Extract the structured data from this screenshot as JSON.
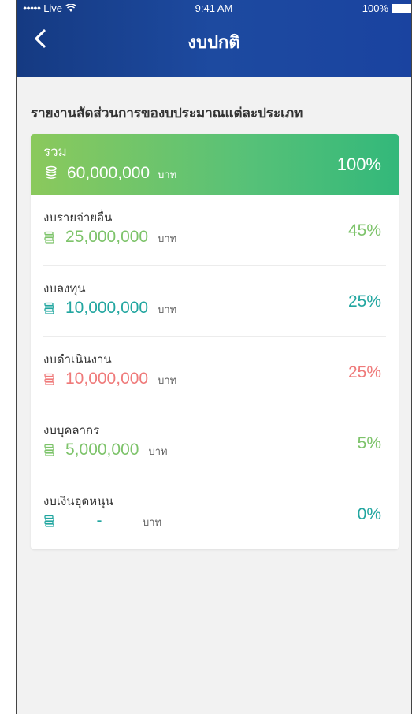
{
  "status_bar": {
    "carrier": "Live",
    "time": "9:41 AM",
    "battery": "100%"
  },
  "nav": {
    "title": "งบปกติ"
  },
  "section_title": "รายงานสัดส่วนการของบประมาณแต่ละประเภท",
  "total": {
    "label": "รวม",
    "amount": "60,000,000",
    "unit": "บาท",
    "percent": "100%"
  },
  "items": [
    {
      "label": "งบรายจ่ายอื่น",
      "amount": "25,000,000",
      "unit": "บาท",
      "percent": "45%",
      "color": "#7dc36a"
    },
    {
      "label": "งบลงทุน",
      "amount": "10,000,000",
      "unit": "บาท",
      "percent": "25%",
      "color": "#22a6a0"
    },
    {
      "label": "งบดำเนินงาน",
      "amount": "10,000,000",
      "unit": "บาท",
      "percent": "25%",
      "color": "#ef7a7a"
    },
    {
      "label": "งบบุคลากร",
      "amount": "5,000,000",
      "unit": "บาท",
      "percent": "5%",
      "color": "#7dc36a"
    },
    {
      "label": "งบเงินอุดหนุน",
      "amount": "-",
      "unit": "บาท",
      "percent": "0%",
      "color": "#22a6a0"
    }
  ],
  "colors": {
    "header": "#1a43a0",
    "total_gradient_start": "#8bc95c",
    "total_gradient_end": "#33b87a"
  },
  "icons": {
    "back": "chevron-left-icon",
    "total": "coin-stack-icon",
    "item": "money-stack-icon"
  }
}
